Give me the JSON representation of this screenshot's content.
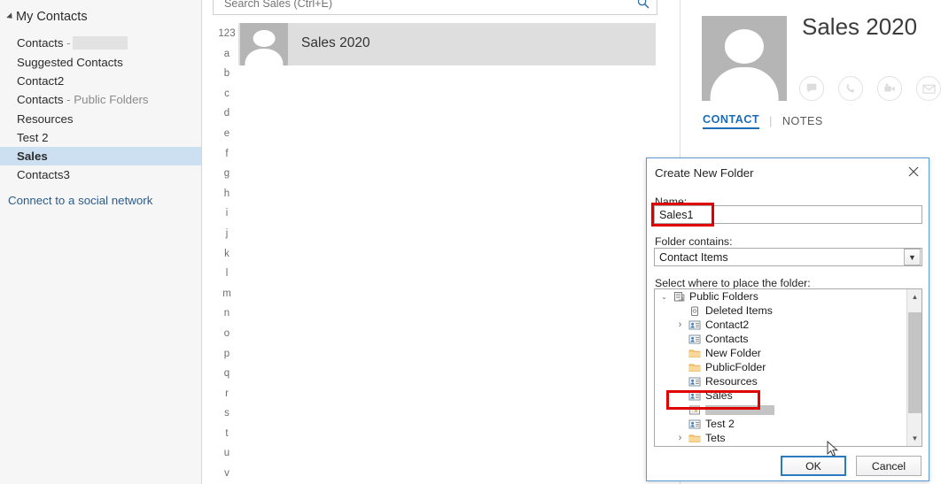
{
  "sidebar": {
    "header": "My Contacts",
    "items": [
      {
        "label": "Contacts",
        "suffix": "-",
        "redacted": true,
        "selected": false
      },
      {
        "label": "Suggested Contacts",
        "suffix": "",
        "redacted": false,
        "selected": false
      },
      {
        "label": "Contact2",
        "suffix": "",
        "redacted": false,
        "selected": false
      },
      {
        "label": "Contacts",
        "suffix": "- Public Folders",
        "redacted": false,
        "selected": false
      },
      {
        "label": "Resources",
        "suffix": "",
        "redacted": false,
        "selected": false
      },
      {
        "label": "Test 2",
        "suffix": "",
        "redacted": false,
        "selected": false
      },
      {
        "label": "Sales",
        "suffix": "",
        "redacted": false,
        "selected": true
      },
      {
        "label": "Contacts3",
        "suffix": "",
        "redacted": false,
        "selected": false
      }
    ],
    "social_link": "Connect to a social network"
  },
  "list_pane": {
    "search_placeholder": "Search Sales (Ctrl+E)",
    "search_value": "",
    "search_icon": "search-icon",
    "alpha_index": [
      "123",
      "a",
      "b",
      "c",
      "d",
      "e",
      "f",
      "g",
      "h",
      "i",
      "j",
      "k",
      "l",
      "m",
      "n",
      "o",
      "p",
      "q",
      "r",
      "s",
      "t",
      "u",
      "v"
    ],
    "contact_row_name": "Sales 2020"
  },
  "reading_pane": {
    "name": "Sales 2020",
    "actions": [
      {
        "icon": "chat-icon"
      },
      {
        "icon": "phone-icon"
      },
      {
        "icon": "video-icon"
      },
      {
        "icon": "mail-icon"
      }
    ],
    "tabs": [
      {
        "label": "CONTACT",
        "active": true
      },
      {
        "label": "NOTES",
        "active": false
      }
    ],
    "tab_separator": "|"
  },
  "dialog": {
    "title": "Create New Folder",
    "close_icon": "close-icon",
    "name_label": "Name:",
    "name_value": "Sales1",
    "contains_label": "Folder contains:",
    "contains_value": "Contact Items",
    "contains_arrow": "chevron-down-icon",
    "place_label": "Select where to place the folder:",
    "tree": [
      {
        "label": "Public Folders",
        "indent": 0,
        "chevron": "down",
        "icon": "public-folders-icon",
        "redacted": false
      },
      {
        "label": "Deleted Items",
        "indent": 1,
        "chevron": "",
        "icon": "deleted-items-icon",
        "redacted": false
      },
      {
        "label": "Contact2",
        "indent": 1,
        "chevron": "right",
        "icon": "contacts-folder-icon",
        "redacted": false
      },
      {
        "label": "Contacts",
        "indent": 1,
        "chevron": "",
        "icon": "contacts-folder-icon",
        "redacted": false
      },
      {
        "label": "New Folder",
        "indent": 1,
        "chevron": "",
        "icon": "folder-icon",
        "redacted": false
      },
      {
        "label": "PublicFolder",
        "indent": 1,
        "chevron": "",
        "icon": "folder-icon",
        "redacted": false
      },
      {
        "label": "Resources",
        "indent": 1,
        "chevron": "",
        "icon": "contacts-folder-icon",
        "redacted": false
      },
      {
        "label": "Sales",
        "indent": 1,
        "chevron": "",
        "icon": "contacts-folder-icon",
        "redacted": false
      },
      {
        "label": "",
        "indent": 1,
        "chevron": "",
        "icon": "calendar-folder-icon",
        "redacted": true
      },
      {
        "label": "Test 2",
        "indent": 1,
        "chevron": "",
        "icon": "contacts-folder-icon",
        "redacted": false
      },
      {
        "label": "Tets",
        "indent": 1,
        "chevron": "right",
        "icon": "folder-icon",
        "redacted": false
      }
    ],
    "scrollbar": {
      "up_icon": "chevron-up-icon",
      "down_icon": "chevron-down-icon"
    },
    "ok_label": "OK",
    "cancel_label": "Cancel"
  },
  "colors": {
    "accent_blue": "#1b6cb5",
    "highlight_red": "#e00000",
    "selection_blue": "#cce0f1",
    "dialog_border": "#5b9bd5"
  }
}
